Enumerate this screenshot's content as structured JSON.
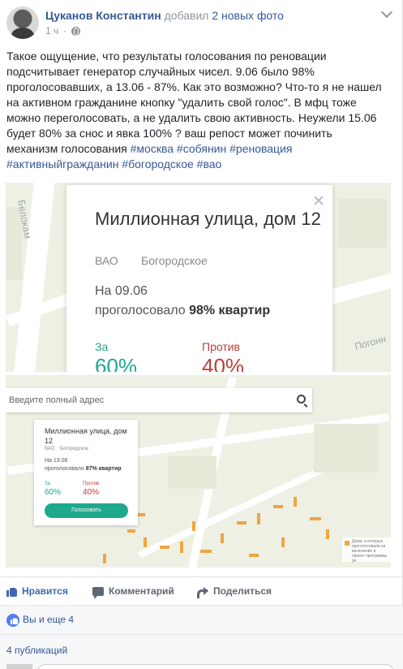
{
  "post": {
    "author": "Цуканов Константин",
    "action": "добавил",
    "action_link": "2 новых фото",
    "time": "1 ч",
    "text_lines": [
      "Такое ощущение, что результаты голосования по реновации",
      "подсчитывает генератор случайных чисел. 9.06 было 98%",
      "проголосовавших, а 13.06 - 87%. Как это возможно? Что-то я не нашел",
      "на активном гражданине кнопку \"удалить свой голос\". В мфц тоже",
      "можно переголосовать, а не удалить свою активность. Неужели 15.06",
      "будет 80% за снос и явка 100% ? ваш репост может починить"
    ],
    "text_last_prefix": "механизм голосования ",
    "hashtags_line1": "#москва #собянин #реновация",
    "hashtags_line2": "#активныйгражданин #богородское #вао"
  },
  "photo1": {
    "street_label": "Белокам",
    "street_label2": "Погонн",
    "title": "Миллионная улица, дом 12",
    "district": "ВАО",
    "area": "Богородское",
    "date": "На 09.06",
    "voted_prefix": "проголосовало",
    "voted_value": "98% квартир",
    "for_label": "За",
    "for_value": "60%",
    "against_label": "Против",
    "against_value": "40%"
  },
  "photo2": {
    "search_placeholder": "Введите полный адрес",
    "title": "Миллионная улица, дом 12",
    "district": "ВАО",
    "area": "Богородское",
    "date": "На 13.06",
    "voted_prefix": "проголосовало",
    "voted_value": "87% квартир",
    "for_label": "За",
    "for_value": "60%",
    "against_label": "Против",
    "against_value": "40%",
    "vote_button": "Голосовать",
    "legend": "Дома, в которых проголосовали за включение в проект программы ре"
  },
  "actions": {
    "like": "Нравится",
    "comment": "Комментарий",
    "share": "Поделиться"
  },
  "reactions": {
    "text": "Вы и еще 4"
  },
  "shares": {
    "text": "4 публикаций"
  },
  "colors": {
    "link": "#365899",
    "like_blue": "#4267b2",
    "vote_green": "#1fa98c",
    "against_red": "#c33b3b",
    "building_orange": "#f0a542"
  }
}
